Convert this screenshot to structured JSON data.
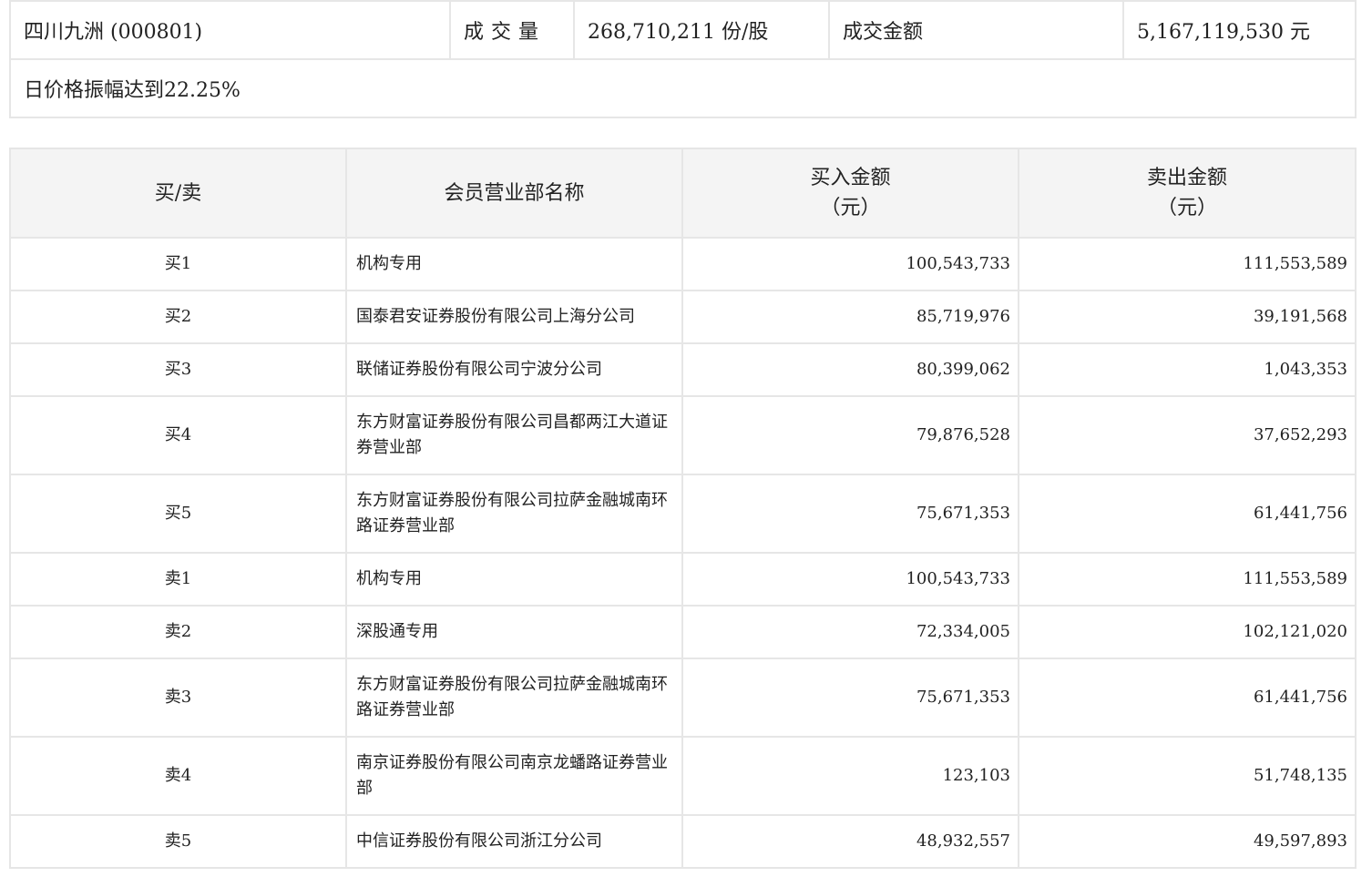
{
  "summary": {
    "stock": "四川九洲 (000801)",
    "volume_label": "成交量",
    "volume_value": "268,710,211 份/股",
    "amount_label": "成交金额",
    "amount_value": "5,167,119,530 元",
    "reason": "日价格振幅达到22.25%"
  },
  "table": {
    "headers": {
      "side": "买/卖",
      "name": "会员营业部名称",
      "buy": "买入金额",
      "buy_unit": "（元）",
      "sell": "卖出金额",
      "sell_unit": "（元）"
    },
    "rows": [
      {
        "side": "买1",
        "name": "机构专用",
        "buy": "100,543,733",
        "sell": "111,553,589"
      },
      {
        "side": "买2",
        "name": "国泰君安证券股份有限公司上海分公司",
        "buy": "85,719,976",
        "sell": "39,191,568"
      },
      {
        "side": "买3",
        "name": "联储证券股份有限公司宁波分公司",
        "buy": "80,399,062",
        "sell": "1,043,353"
      },
      {
        "side": "买4",
        "name": "东方财富证券股份有限公司昌都两江大道证券营业部",
        "buy": "79,876,528",
        "sell": "37,652,293"
      },
      {
        "side": "买5",
        "name": "东方财富证券股份有限公司拉萨金融城南环路证券营业部",
        "buy": "75,671,353",
        "sell": "61,441,756"
      },
      {
        "side": "卖1",
        "name": "机构专用",
        "buy": "100,543,733",
        "sell": "111,553,589"
      },
      {
        "side": "卖2",
        "name": "深股通专用",
        "buy": "72,334,005",
        "sell": "102,121,020"
      },
      {
        "side": "卖3",
        "name": "东方财富证券股份有限公司拉萨金融城南环路证券营业部",
        "buy": "75,671,353",
        "sell": "61,441,756"
      },
      {
        "side": "卖4",
        "name": "南京证券股份有限公司南京龙蟠路证券营业部",
        "buy": "123,103",
        "sell": "51,748,135"
      },
      {
        "side": "卖5",
        "name": "中信证券股份有限公司浙江分公司",
        "buy": "48,932,557",
        "sell": "49,597,893"
      }
    ]
  }
}
